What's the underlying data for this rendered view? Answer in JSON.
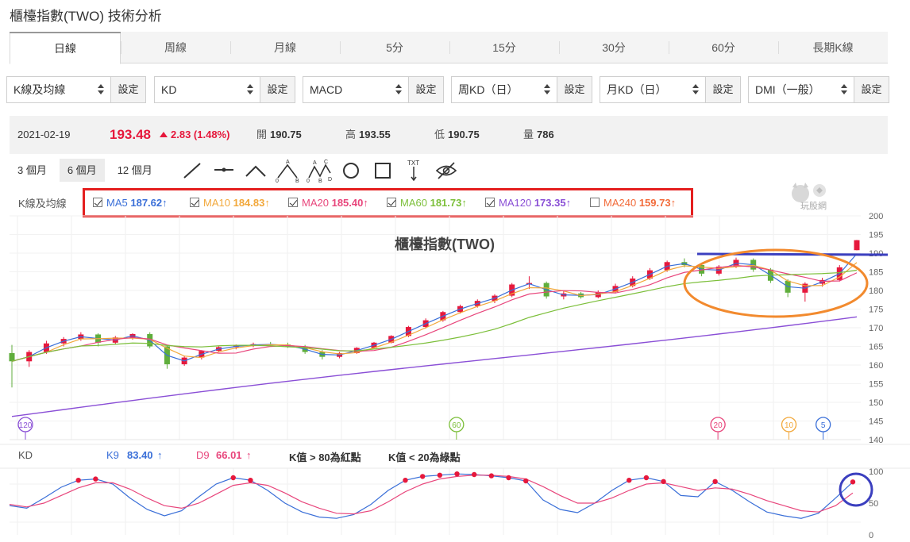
{
  "page": {
    "title": "櫃檯指數(TWO) 技術分析"
  },
  "tabs": [
    "日線",
    "周線",
    "月線",
    "5分",
    "15分",
    "30分",
    "60分",
    "長期K線"
  ],
  "active_tab": 0,
  "selectors": [
    {
      "label": "K線及均線",
      "setting": "設定"
    },
    {
      "label": "KD",
      "setting": "設定"
    },
    {
      "label": "MACD",
      "setting": "設定"
    },
    {
      "label": "周KD（日）",
      "setting": "設定"
    },
    {
      "label": "月KD（日）",
      "setting": "設定"
    },
    {
      "label": "DMI（一般）",
      "setting": "設定"
    }
  ],
  "quote": {
    "date": "2021-02-19",
    "price": "193.48",
    "change": "2.83 (1.48%)",
    "open_label": "開",
    "open": "190.75",
    "high_label": "高",
    "high": "193.55",
    "low_label": "低",
    "low": "190.75",
    "volume_label": "量",
    "volume": "786"
  },
  "ranges": [
    "3 個月",
    "6 個月",
    "12 個月"
  ],
  "active_range": 1,
  "tools": [
    "line-tool-icon",
    "horizontal-line-tool-icon",
    "angle-tool-icon",
    "abc-pattern-icon",
    "abcd-pattern-icon",
    "circle-tool-icon",
    "rectangle-tool-icon",
    "text-tool-icon",
    "hide-drawings-icon"
  ],
  "tool_text": {
    "txt": "TXT",
    "a": "A",
    "b": "B",
    "c": "C",
    "d": "D",
    "zero": "0"
  },
  "ma_panel": {
    "label": "K線及均線",
    "items": [
      {
        "name": "MA5",
        "value": "187.62",
        "arrow": "↑",
        "checked": true,
        "color": "#3a6fd8"
      },
      {
        "name": "MA10",
        "value": "184.83",
        "arrow": "↑",
        "checked": true,
        "color": "#f2a83b"
      },
      {
        "name": "MA20",
        "value": "185.40",
        "arrow": "↑",
        "checked": true,
        "color": "#e8467c"
      },
      {
        "name": "MA60",
        "value": "181.73",
        "arrow": "↑",
        "checked": true,
        "color": "#7cbf3a"
      },
      {
        "name": "MA120",
        "value": "173.35",
        "arrow": "↑",
        "checked": true,
        "color": "#8a4fd6"
      },
      {
        "name": "MA240",
        "value": "159.73",
        "arrow": "↑",
        "checked": false,
        "color": "#f26b3a"
      }
    ]
  },
  "logo_text": "玩股網",
  "colors": {
    "up": "#e6183c",
    "down": "#5fae3c",
    "annotation_box": "#e41f1f",
    "annotation_ellipse": "#f28a2e",
    "annotation_line": "#3b3fbf",
    "annotation_circle": "#3b3fbf"
  },
  "kd_panel": {
    "label": "KD",
    "k_name": "K9",
    "k_value": "83.40",
    "k_arrow": "↑",
    "d_name": "D9",
    "d_value": "66.01",
    "d_arrow": "↑",
    "note_high": "K值 > 80為紅點",
    "note_low": "K值 < 20為綠點"
  },
  "chart_data": [
    {
      "type": "candlestick",
      "title": "櫃檯指數(TWO)",
      "ylim": [
        140,
        200
      ],
      "yticks": [
        "140",
        "145",
        "150",
        "155",
        "160",
        "165",
        "170",
        "175",
        "180",
        "185",
        "190",
        "195",
        "200"
      ],
      "ohlc_sampled": [
        [
          163.2,
          165.4,
          154.0,
          161.0
        ],
        [
          161.0,
          164.0,
          159.5,
          163.5
        ],
        [
          163.5,
          166.5,
          163.0,
          165.8
        ],
        [
          165.8,
          167.5,
          165.0,
          167.0
        ],
        [
          167.0,
          168.8,
          166.5,
          168.2
        ],
        [
          168.2,
          168.5,
          165.0,
          166.0
        ],
        [
          166.0,
          167.8,
          165.5,
          167.4
        ],
        [
          167.4,
          168.5,
          166.8,
          168.3
        ],
        [
          168.3,
          168.8,
          164.5,
          165.0
        ],
        [
          165.0,
          165.4,
          159.0,
          160.2
        ],
        [
          160.2,
          162.5,
          159.8,
          162.0
        ],
        [
          162.0,
          164.0,
          161.5,
          163.8
        ],
        [
          163.8,
          165.0,
          163.5,
          164.8
        ],
        [
          164.8,
          165.5,
          164.2,
          165.2
        ],
        [
          165.2,
          166.0,
          164.8,
          165.6
        ],
        [
          165.6,
          166.2,
          165.0,
          165.5
        ],
        [
          165.5,
          166.0,
          164.6,
          165.0
        ],
        [
          165.0,
          165.4,
          163.0,
          163.5
        ],
        [
          163.5,
          164.0,
          161.5,
          162.2
        ],
        [
          162.2,
          163.5,
          161.8,
          163.2
        ],
        [
          163.2,
          164.8,
          163.0,
          164.6
        ],
        [
          164.6,
          166.2,
          164.4,
          166.0
        ],
        [
          166.0,
          168.0,
          165.8,
          167.8
        ],
        [
          167.8,
          170.5,
          167.5,
          170.2
        ],
        [
          170.2,
          172.5,
          169.8,
          172.0
        ],
        [
          172.0,
          174.5,
          171.6,
          174.2
        ],
        [
          174.2,
          176.2,
          173.8,
          175.8
        ],
        [
          175.8,
          177.6,
          175.4,
          177.2
        ],
        [
          177.2,
          179.0,
          176.6,
          178.6
        ],
        [
          178.6,
          182.0,
          178.2,
          181.6
        ],
        [
          181.6,
          183.8,
          180.4,
          182.0
        ],
        [
          182.0,
          182.4,
          177.8,
          178.4
        ],
        [
          178.4,
          179.8,
          177.6,
          179.2
        ],
        [
          179.2,
          179.6,
          177.8,
          178.2
        ],
        [
          178.2,
          180.0,
          177.9,
          179.6
        ],
        [
          179.6,
          181.8,
          179.2,
          181.2
        ],
        [
          181.2,
          183.8,
          180.8,
          183.2
        ],
        [
          183.2,
          186.0,
          182.8,
          185.4
        ],
        [
          185.4,
          188.0,
          185.0,
          187.6
        ],
        [
          187.6,
          188.6,
          186.2,
          186.8
        ],
        [
          186.8,
          187.2,
          183.8,
          184.5
        ],
        [
          184.5,
          186.8,
          184.0,
          186.4
        ],
        [
          186.4,
          188.8,
          186.0,
          188.2
        ],
        [
          188.2,
          188.6,
          185.0,
          185.6
        ],
        [
          185.6,
          186.0,
          182.0,
          182.6
        ],
        [
          182.6,
          183.0,
          178.2,
          179.4
        ],
        [
          179.4,
          182.2,
          177.0,
          181.8
        ],
        [
          181.8,
          183.4,
          181.0,
          182.8
        ],
        [
          182.8,
          186.8,
          182.4,
          186.2
        ],
        [
          190.8,
          193.55,
          190.75,
          193.48
        ]
      ],
      "ma_series": [
        "MA5",
        "MA10",
        "MA20",
        "MA60",
        "MA120"
      ],
      "ma_markers": [
        {
          "label": "120",
          "x_fraction": 0.0
        },
        {
          "label": "60",
          "x_fraction": 0.516
        },
        {
          "label": "20",
          "x_fraction": 0.829
        },
        {
          "label": "10",
          "x_fraction": 0.914
        },
        {
          "label": "5",
          "x_fraction": 0.955
        }
      ]
    },
    {
      "type": "line",
      "title": "KD",
      "ylim": [
        0,
        100
      ],
      "yticks": [
        "0",
        "50",
        "100"
      ],
      "series": [
        {
          "name": "K9",
          "values": [
            46,
            42,
            58,
            75,
            86,
            88,
            80,
            58,
            40,
            30,
            38,
            60,
            80,
            90,
            86,
            70,
            50,
            36,
            28,
            26,
            32,
            48,
            70,
            86,
            92,
            94,
            96,
            95,
            93,
            90,
            85,
            55,
            40,
            35,
            50,
            70,
            86,
            90,
            84,
            62,
            60,
            84,
            70,
            52,
            36,
            30,
            26,
            34,
            58,
            83.4
          ]
        },
        {
          "name": "D9",
          "values": [
            48,
            44,
            50,
            62,
            74,
            82,
            82,
            72,
            58,
            46,
            42,
            50,
            64,
            78,
            82,
            78,
            66,
            52,
            42,
            34,
            33,
            38,
            52,
            68,
            80,
            88,
            92,
            94,
            94,
            92,
            88,
            76,
            62,
            50,
            50,
            58,
            70,
            80,
            82,
            76,
            70,
            74,
            72,
            64,
            54,
            46,
            38,
            36,
            46,
            66.01
          ]
        }
      ]
    }
  ]
}
